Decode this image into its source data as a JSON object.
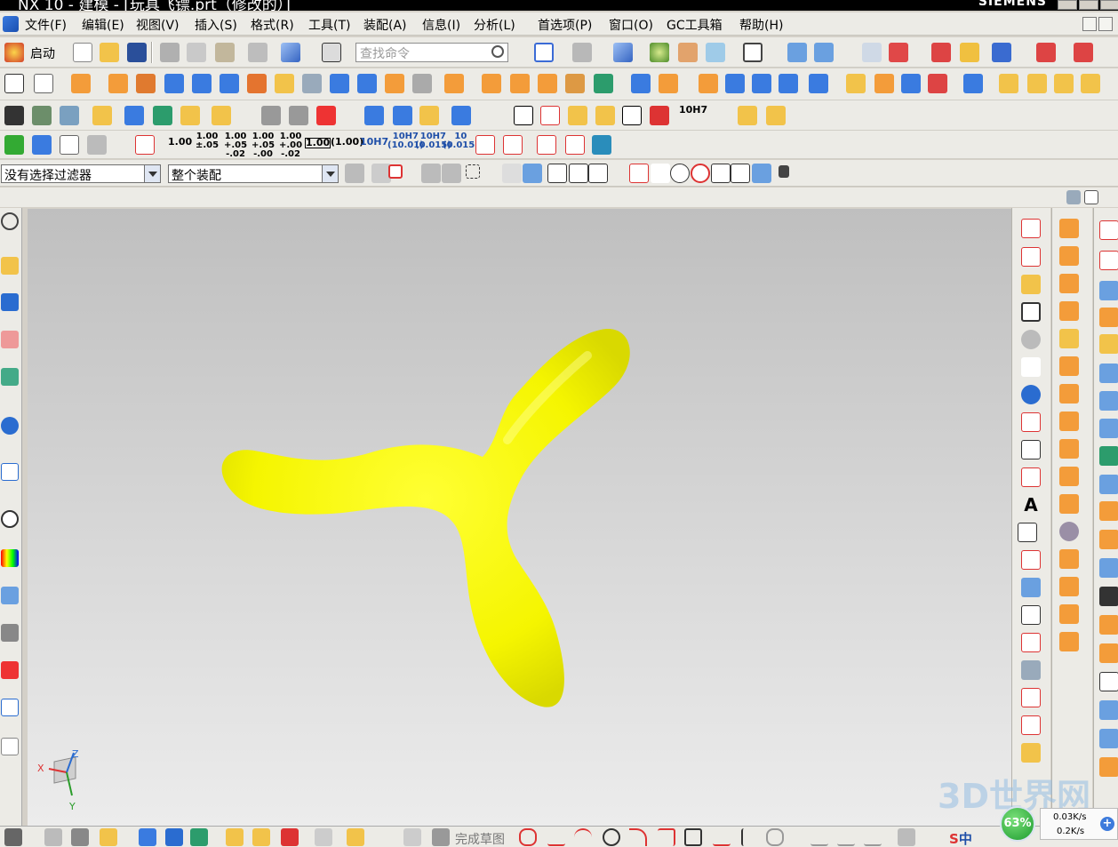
{
  "window": {
    "title": "NX 10 - 建模 - [玩具飞镖.prt（修改的）]",
    "brand": "SIEMENS"
  },
  "menu": {
    "items": [
      "文件(F)",
      "编辑(E)",
      "视图(V)",
      "插入(S)",
      "格式(R)",
      "工具(T)",
      "装配(A)",
      "信息(I)",
      "分析(L)",
      "首选项(P)",
      "窗口(O)",
      "GC工具箱",
      "帮助(H)"
    ]
  },
  "toolbar": {
    "start_label": "启动",
    "search_placeholder": "查找命令",
    "dim_labels": [
      "1.00",
      "1.00\n±.05",
      "1.00\n+.05\n-.02",
      "1.00\n+.05\n-.00",
      "1.00\n+.00\n-.02",
      "1.00",
      "(1.00)",
      "10H7",
      "10H7\n(10.01)",
      "10H7\n(0.015)",
      "10\n(0.015)"
    ],
    "fit_label": "10H7"
  },
  "filterbar": {
    "selection_filter": "没有选择过滤器",
    "scope": "整个装配"
  },
  "viewport": {
    "model_name": "玩具飞镖",
    "model_color": "#ffff00",
    "triad": {
      "x": "X",
      "y": "Y",
      "z": "Z"
    }
  },
  "bottombar": {
    "finish_sketch_label": "完成草图"
  },
  "status": {
    "watermark": "3D世界网",
    "ime_label": "中",
    "net_percent": "63%",
    "upload": "0.03K/s",
    "download": "0.2K/s"
  }
}
